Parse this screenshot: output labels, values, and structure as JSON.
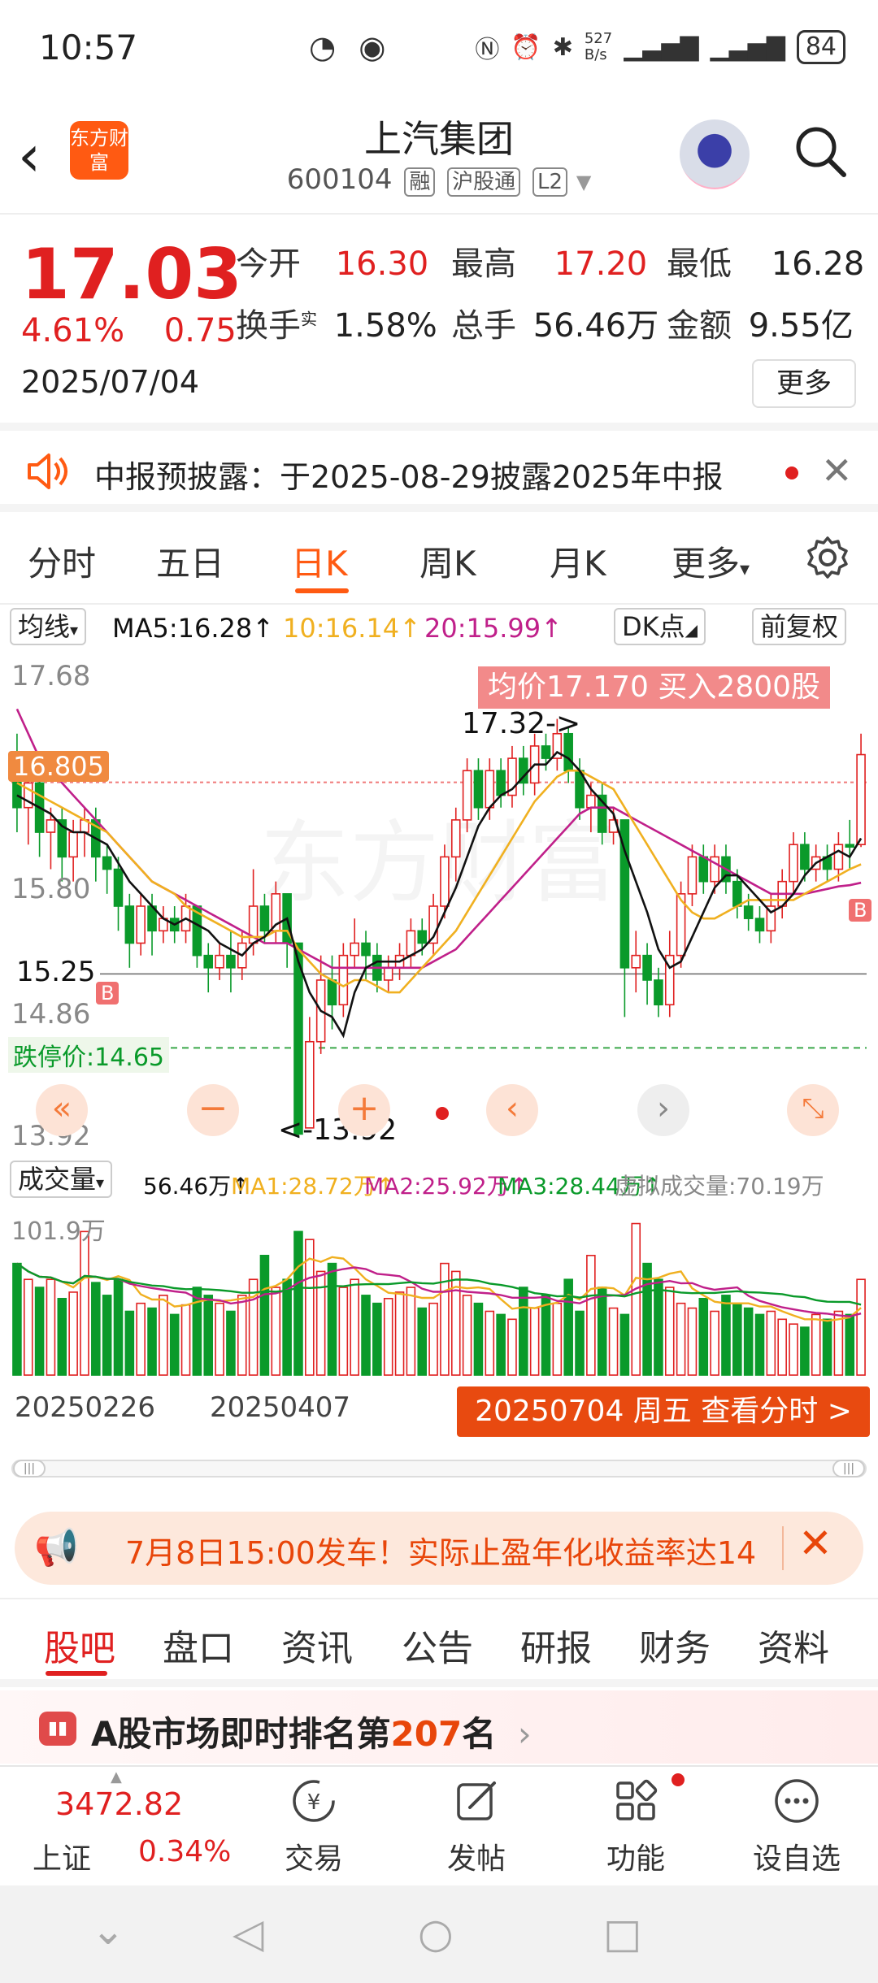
{
  "status": {
    "time": "10:57",
    "net_speed": "527\nB/s",
    "battery": "84"
  },
  "header": {
    "logo_text": "东方财富",
    "name": "上汽集团",
    "code": "600104",
    "tags": [
      "融",
      "沪股通",
      "L2"
    ]
  },
  "quote": {
    "price": "17.03",
    "change_pct": "4.61%",
    "change_amt": "0.75",
    "date": "2025/07/04",
    "open_label": "今开",
    "open": "16.30",
    "high_label": "最高",
    "high": "17.20",
    "low_label": "最低",
    "low": "16.28",
    "turnover_label": "换手",
    "turnover_sup": "实",
    "turnover": "1.58%",
    "volume_label": "总手",
    "volume": "56.46万",
    "amount_label": "金额",
    "amount": "9.55亿",
    "more": "更多"
  },
  "notice": {
    "text": "中报预披露：于2025-08-29披露2025年中报"
  },
  "ktabs": [
    "分时",
    "五日",
    "日K",
    "周K",
    "月K",
    "更多"
  ],
  "ma_row": {
    "select": "均线",
    "ma5": "MA5:16.28↑",
    "ma10": "10:16.14↑",
    "ma20": "20:15.99↑",
    "dk": "DK点",
    "fq": "前复权"
  },
  "colors": {
    "up": "#e02020",
    "down": "#0a9a2a",
    "ma5": "#111111",
    "ma10": "#f0b020",
    "ma20": "#c0208a",
    "accent": "#ff5a12"
  },
  "kchart": {
    "y_labels": [
      "17.68",
      "16.805",
      "15.80",
      "15.25",
      "14.86",
      "13.92"
    ],
    "ceiling_label": "均价17.170  买入2800股",
    "high_mark": "17.32->",
    "low_mark": "<-13.92",
    "limit_down_label": "跌停价:14.65",
    "b_marker": "B"
  },
  "chart_data": {
    "type": "candlestick",
    "ylim": [
      13.92,
      17.68
    ],
    "candles": [
      {
        "o": 16.9,
        "c": 16.6,
        "h": 17.2,
        "l": 16.4
      },
      {
        "o": 16.6,
        "c": 16.8,
        "h": 16.9,
        "l": 16.3
      },
      {
        "o": 16.8,
        "c": 16.4,
        "h": 16.9,
        "l": 16.2
      },
      {
        "o": 16.4,
        "c": 16.5,
        "h": 16.6,
        "l": 16.1
      },
      {
        "o": 16.5,
        "c": 16.2,
        "h": 16.6,
        "l": 16.0
      },
      {
        "o": 16.2,
        "c": 16.4,
        "h": 16.5,
        "l": 16.0
      },
      {
        "o": 16.4,
        "c": 16.5,
        "h": 16.6,
        "l": 16.2
      },
      {
        "o": 16.5,
        "c": 16.2,
        "h": 16.6,
        "l": 16.0
      },
      {
        "o": 16.2,
        "c": 16.1,
        "h": 16.3,
        "l": 15.9
      },
      {
        "o": 16.1,
        "c": 15.8,
        "h": 16.2,
        "l": 15.6
      },
      {
        "o": 15.8,
        "c": 15.5,
        "h": 15.9,
        "l": 15.3
      },
      {
        "o": 15.5,
        "c": 15.8,
        "h": 15.9,
        "l": 15.4
      },
      {
        "o": 15.8,
        "c": 15.6,
        "h": 15.9,
        "l": 15.4
      },
      {
        "o": 15.6,
        "c": 15.7,
        "h": 15.8,
        "l": 15.5
      },
      {
        "o": 15.7,
        "c": 15.6,
        "h": 15.8,
        "l": 15.5
      },
      {
        "o": 15.6,
        "c": 15.8,
        "h": 15.9,
        "l": 15.5
      },
      {
        "o": 15.8,
        "c": 15.4,
        "h": 15.8,
        "l": 15.3
      },
      {
        "o": 15.4,
        "c": 15.3,
        "h": 15.5,
        "l": 15.1
      },
      {
        "o": 15.3,
        "c": 15.4,
        "h": 15.5,
        "l": 15.2
      },
      {
        "o": 15.4,
        "c": 15.3,
        "h": 15.6,
        "l": 15.1
      },
      {
        "o": 15.3,
        "c": 15.5,
        "h": 15.6,
        "l": 15.2
      },
      {
        "o": 15.5,
        "c": 15.8,
        "h": 16.1,
        "l": 15.4
      },
      {
        "o": 15.8,
        "c": 15.6,
        "h": 15.9,
        "l": 15.5
      },
      {
        "o": 15.6,
        "c": 15.9,
        "h": 16.0,
        "l": 15.5
      },
      {
        "o": 15.9,
        "c": 15.5,
        "h": 15.9,
        "l": 15.3
      },
      {
        "o": 15.5,
        "c": 13.95,
        "h": 15.5,
        "l": 13.92
      },
      {
        "o": 14.0,
        "c": 14.7,
        "h": 14.9,
        "l": 14.0
      },
      {
        "o": 14.7,
        "c": 15.2,
        "h": 15.4,
        "l": 14.6
      },
      {
        "o": 15.2,
        "c": 15.0,
        "h": 15.4,
        "l": 14.8
      },
      {
        "o": 15.0,
        "c": 15.4,
        "h": 15.5,
        "l": 14.9
      },
      {
        "o": 15.4,
        "c": 15.5,
        "h": 15.7,
        "l": 15.3
      },
      {
        "o": 15.5,
        "c": 15.4,
        "h": 15.6,
        "l": 15.2
      },
      {
        "o": 15.4,
        "c": 15.2,
        "h": 15.5,
        "l": 15.1
      },
      {
        "o": 15.2,
        "c": 15.3,
        "h": 15.4,
        "l": 15.1
      },
      {
        "o": 15.3,
        "c": 15.4,
        "h": 15.5,
        "l": 15.2
      },
      {
        "o": 15.4,
        "c": 15.6,
        "h": 15.7,
        "l": 15.3
      },
      {
        "o": 15.6,
        "c": 15.5,
        "h": 15.7,
        "l": 15.4
      },
      {
        "o": 15.5,
        "c": 15.8,
        "h": 15.9,
        "l": 15.4
      },
      {
        "o": 15.8,
        "c": 16.2,
        "h": 16.3,
        "l": 15.7
      },
      {
        "o": 16.2,
        "c": 16.5,
        "h": 16.6,
        "l": 16.0
      },
      {
        "o": 16.5,
        "c": 16.9,
        "h": 17.0,
        "l": 16.4
      },
      {
        "o": 16.9,
        "c": 16.6,
        "h": 17.0,
        "l": 16.5
      },
      {
        "o": 16.6,
        "c": 16.9,
        "h": 17.0,
        "l": 16.5
      },
      {
        "o": 16.9,
        "c": 16.7,
        "h": 17.0,
        "l": 16.6
      },
      {
        "o": 16.7,
        "c": 17.0,
        "h": 17.1,
        "l": 16.6
      },
      {
        "o": 17.0,
        "c": 16.8,
        "h": 17.1,
        "l": 16.7
      },
      {
        "o": 16.8,
        "c": 17.1,
        "h": 17.2,
        "l": 16.7
      },
      {
        "o": 17.1,
        "c": 17.0,
        "h": 17.2,
        "l": 16.9
      },
      {
        "o": 17.0,
        "c": 17.2,
        "h": 17.32,
        "l": 16.9
      },
      {
        "o": 17.2,
        "c": 16.9,
        "h": 17.25,
        "l": 16.8
      },
      {
        "o": 16.9,
        "c": 16.6,
        "h": 17.0,
        "l": 16.5
      },
      {
        "o": 16.6,
        "c": 16.7,
        "h": 16.8,
        "l": 16.4
      },
      {
        "o": 16.7,
        "c": 16.4,
        "h": 16.8,
        "l": 16.3
      },
      {
        "o": 16.4,
        "c": 16.5,
        "h": 16.6,
        "l": 16.3
      },
      {
        "o": 16.5,
        "c": 15.3,
        "h": 16.5,
        "l": 14.9
      },
      {
        "o": 15.3,
        "c": 15.4,
        "h": 15.6,
        "l": 15.1
      },
      {
        "o": 15.4,
        "c": 15.2,
        "h": 15.5,
        "l": 15.0
      },
      {
        "o": 15.2,
        "c": 15.0,
        "h": 15.3,
        "l": 14.9
      },
      {
        "o": 15.0,
        "c": 15.4,
        "h": 15.6,
        "l": 14.9
      },
      {
        "o": 15.4,
        "c": 15.9,
        "h": 16.0,
        "l": 15.3
      },
      {
        "o": 15.9,
        "c": 16.2,
        "h": 16.3,
        "l": 15.8
      },
      {
        "o": 16.2,
        "c": 16.0,
        "h": 16.3,
        "l": 15.9
      },
      {
        "o": 16.0,
        "c": 16.2,
        "h": 16.3,
        "l": 15.9
      },
      {
        "o": 16.2,
        "c": 16.0,
        "h": 16.3,
        "l": 15.9
      },
      {
        "o": 16.0,
        "c": 15.8,
        "h": 16.1,
        "l": 15.7
      },
      {
        "o": 15.8,
        "c": 15.7,
        "h": 15.9,
        "l": 15.6
      },
      {
        "o": 15.7,
        "c": 15.6,
        "h": 15.8,
        "l": 15.5
      },
      {
        "o": 15.6,
        "c": 15.8,
        "h": 15.9,
        "l": 15.5
      },
      {
        "o": 15.8,
        "c": 16.0,
        "h": 16.1,
        "l": 15.7
      },
      {
        "o": 16.0,
        "c": 16.3,
        "h": 16.4,
        "l": 15.9
      },
      {
        "o": 16.3,
        "c": 16.1,
        "h": 16.4,
        "l": 16.0
      },
      {
        "o": 16.1,
        "c": 16.2,
        "h": 16.3,
        "l": 16.0
      },
      {
        "o": 16.2,
        "c": 16.1,
        "h": 16.3,
        "l": 16.0
      },
      {
        "o": 16.1,
        "c": 16.3,
        "h": 16.4,
        "l": 16.0
      },
      {
        "o": 16.3,
        "c": 16.28,
        "h": 16.5,
        "l": 16.1
      },
      {
        "o": 16.3,
        "c": 17.03,
        "h": 17.2,
        "l": 16.28
      }
    ],
    "ma5": [
      16.7,
      16.65,
      16.6,
      16.55,
      16.45,
      16.4,
      16.4,
      16.35,
      16.3,
      16.15,
      16.0,
      15.9,
      15.8,
      15.7,
      15.65,
      15.7,
      15.65,
      15.6,
      15.5,
      15.45,
      15.4,
      15.5,
      15.55,
      15.65,
      15.7,
      15.35,
      15.1,
      14.95,
      14.9,
      14.75,
      15.1,
      15.3,
      15.35,
      15.35,
      15.35,
      15.4,
      15.45,
      15.55,
      15.75,
      15.95,
      16.2,
      16.45,
      16.6,
      16.7,
      16.75,
      16.85,
      16.95,
      16.95,
      17.05,
      17.0,
      16.9,
      16.75,
      16.65,
      16.55,
      16.25,
      16.0,
      15.75,
      15.45,
      15.3,
      15.35,
      15.55,
      15.75,
      15.95,
      16.05,
      16.05,
      15.95,
      15.85,
      15.75,
      15.8,
      15.9,
      16.05,
      16.15,
      16.2,
      16.25,
      16.2,
      16.35
    ],
    "ma10": [
      16.8,
      16.75,
      16.7,
      16.65,
      16.6,
      16.55,
      16.5,
      16.45,
      16.4,
      16.3,
      16.2,
      16.1,
      16.0,
      15.95,
      15.9,
      15.8,
      15.75,
      15.7,
      15.65,
      15.6,
      15.55,
      15.55,
      15.55,
      15.6,
      15.6,
      15.45,
      15.35,
      15.25,
      15.2,
      15.15,
      15.2,
      15.2,
      15.15,
      15.1,
      15.1,
      15.2,
      15.3,
      15.4,
      15.5,
      15.6,
      15.75,
      15.9,
      16.05,
      16.2,
      16.35,
      16.5,
      16.65,
      16.75,
      16.85,
      16.9,
      16.9,
      16.85,
      16.8,
      16.75,
      16.6,
      16.45,
      16.3,
      16.15,
      16.0,
      15.85,
      15.75,
      15.7,
      15.7,
      15.75,
      15.8,
      15.85,
      15.85,
      15.85,
      15.85,
      15.85,
      15.9,
      15.95,
      16.0,
      16.05,
      16.1,
      16.14
    ],
    "ma20": [
      17.4,
      17.2,
      17.0,
      16.9,
      16.8,
      16.7,
      16.6,
      16.5,
      16.4,
      16.3,
      16.2,
      16.1,
      16.0,
      15.95,
      15.9,
      15.85,
      15.8,
      15.75,
      15.7,
      15.65,
      15.6,
      15.55,
      15.5,
      15.5,
      15.5,
      15.45,
      15.4,
      15.35,
      15.3,
      15.3,
      15.3,
      15.3,
      15.3,
      15.3,
      15.3,
      15.3,
      15.3,
      15.35,
      15.4,
      15.45,
      15.55,
      15.65,
      15.75,
      15.85,
      15.95,
      16.05,
      16.15,
      16.25,
      16.35,
      16.45,
      16.55,
      16.6,
      16.6,
      16.6,
      16.55,
      16.5,
      16.45,
      16.4,
      16.35,
      16.3,
      16.25,
      16.2,
      16.15,
      16.1,
      16.05,
      16.0,
      15.95,
      15.9,
      15.9,
      15.9,
      15.9,
      15.92,
      15.94,
      15.96,
      15.97,
      15.99
    ],
    "volume_ylabel": "101.9万",
    "volumes": [
      70,
      60,
      55,
      60,
      48,
      52,
      90,
      58,
      50,
      60,
      40,
      45,
      42,
      50,
      38,
      44,
      55,
      50,
      45,
      40,
      50,
      60,
      75,
      55,
      60,
      90,
      85,
      65,
      70,
      55,
      60,
      50,
      45,
      48,
      52,
      55,
      42,
      45,
      70,
      65,
      50,
      45,
      40,
      38,
      35,
      55,
      42,
      50,
      45,
      60,
      40,
      75,
      55,
      42,
      38,
      95,
      70,
      60,
      55,
      45,
      42,
      48,
      40,
      50,
      45,
      42,
      38,
      40,
      35,
      32,
      30,
      38,
      35,
      40,
      38,
      60
    ]
  },
  "volume_head": {
    "select": "成交量",
    "vol": "56.46万↑",
    "ma1": "MA1:28.72万↑",
    "ma2": "MA2:25.92万↑",
    "ma3": "MA3:28.44万↑",
    "virtual": "虚拟成交量:70.19万"
  },
  "dates": {
    "d1": "20250226",
    "d2": "20250407",
    "selected": "20250704 周五 查看分时 >"
  },
  "promo": {
    "text": "7月8日15:00发车！实际止盈年化收益率达14"
  },
  "btabs": [
    "股吧",
    "盘口",
    "资讯",
    "公告",
    "研报",
    "财务",
    "资料"
  ],
  "rank": {
    "prefix": "A股市场即时排名第",
    "num": "207",
    "suffix": "名"
  },
  "bnav": {
    "index_value": "3472.82",
    "index_name": "上证",
    "index_pct": "0.34%",
    "items": [
      "交易",
      "发帖",
      "功能",
      "设自选"
    ]
  }
}
